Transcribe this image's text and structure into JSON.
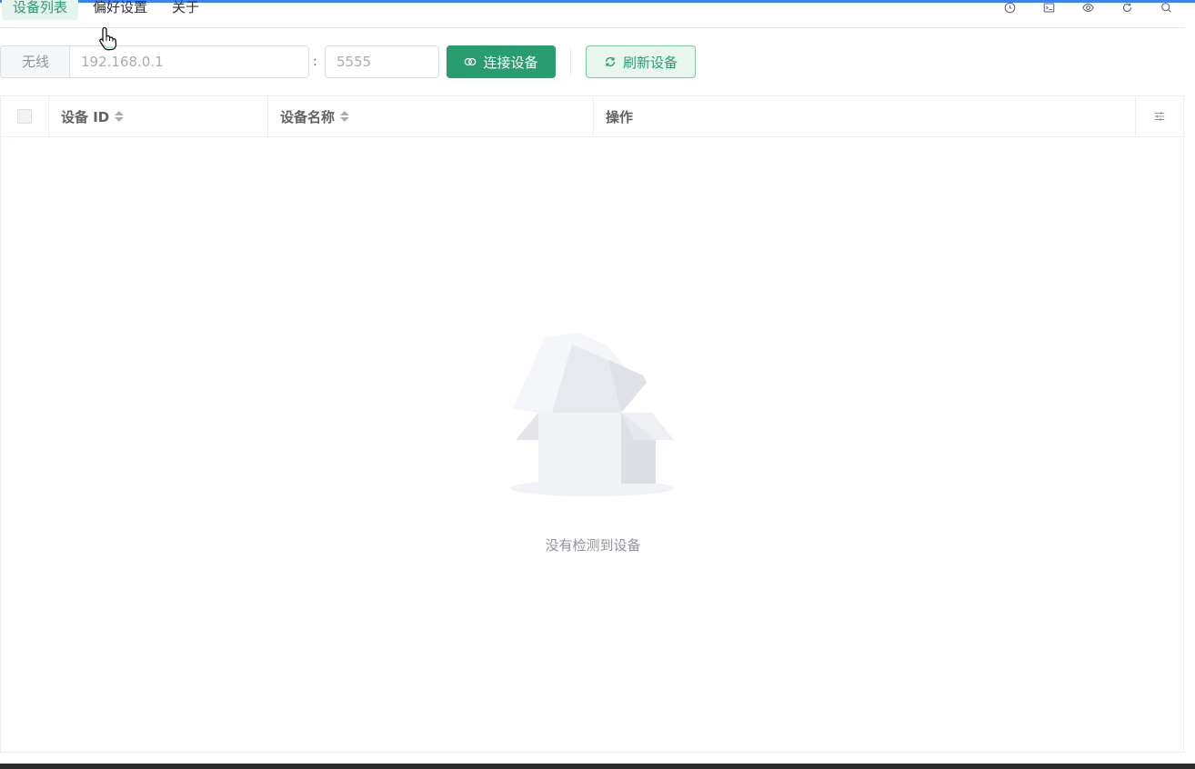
{
  "tabs": [
    {
      "label": "设备列表",
      "active": true
    },
    {
      "label": "偏好设置",
      "active": false
    },
    {
      "label": "关于",
      "active": false
    }
  ],
  "header_icons": [
    "history-icon",
    "terminal-icon",
    "eye-icon",
    "refresh-icon",
    "search-icon"
  ],
  "toolbar": {
    "mode_label": "无线",
    "ip_placeholder": "192.168.0.1",
    "separator": ":",
    "port_placeholder": "5555",
    "connect_label": "连接设备",
    "refresh_label": "刷新设备"
  },
  "table": {
    "columns": [
      {
        "label": "设备 ID",
        "sortable": true
      },
      {
        "label": "设备名称",
        "sortable": true
      },
      {
        "label": "操作",
        "sortable": false
      }
    ],
    "rows": [],
    "empty_text": "没有检测到设备"
  },
  "colors": {
    "accent": "#2a9d70",
    "accent_light": "#e9f6f0",
    "top_bar": "#3b82f6"
  }
}
